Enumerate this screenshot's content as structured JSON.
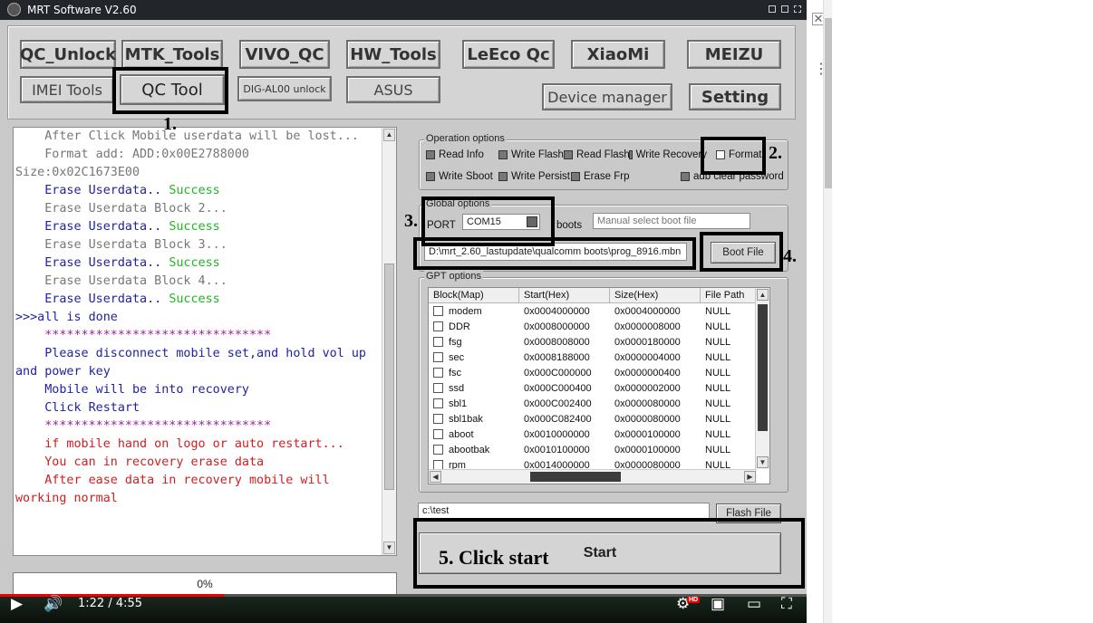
{
  "window": {
    "title": "MRT Software V2.60"
  },
  "top_buttons": {
    "qc_unlock": "QC_Unlock",
    "mtk_tools": "MTK_Tools",
    "vivo_qc": "VIVO_QC",
    "hw_tools": "HW_Tools",
    "leeco_qc": "LeEco Qc",
    "xiaomi": "XiaoMi",
    "meizu": "MEIZU",
    "imei_tools": "IMEI Tools",
    "qc_tool": "QC Tool",
    "dig_unlock": "DIG-AL00 unlock",
    "asus": "ASUS",
    "device_manager": "Device manager",
    "setting": "Setting"
  },
  "log_lines": [
    {
      "text": "    After Click Mobile userdata will be lost...",
      "color": "#777777"
    },
    {
      "text": "    Format add: ADD:0x00E2788000",
      "color": "#777777"
    },
    {
      "text": "Size:0x02C1673E00",
      "color": "#777777"
    },
    {
      "text": "    Erase Userdata.. ",
      "color": "#1f1fa0",
      "suffix": "Success",
      "suffix_color": "#22b422"
    },
    {
      "text": "    Erase Userdata Block 2...",
      "color": "#777777"
    },
    {
      "text": "    Erase Userdata.. ",
      "color": "#1f1fa0",
      "suffix": "Success",
      "suffix_color": "#22b422"
    },
    {
      "text": "    Erase Userdata Block 3...",
      "color": "#777777"
    },
    {
      "text": "    Erase Userdata.. ",
      "color": "#1f1fa0",
      "suffix": "Success",
      "suffix_color": "#22b422"
    },
    {
      "text": "    Erase Userdata Block 4...",
      "color": "#777777"
    },
    {
      "text": "    Erase Userdata.. ",
      "color": "#1f1fa0",
      "suffix": "Success",
      "suffix_color": "#22b422"
    },
    {
      "text": ">>>all is done",
      "color": "#1f1fa0"
    },
    {
      "text": "    *******************************",
      "color": "#a020a0"
    },
    {
      "text": "    Please disconnect mobile set,and hold vol up",
      "color": "#1f1fa0"
    },
    {
      "text": "and power key",
      "color": "#1f1fa0"
    },
    {
      "text": "    Mobile will be into recovery",
      "color": "#1f1fa0"
    },
    {
      "text": "    Click Restart",
      "color": "#1f1fa0"
    },
    {
      "text": "    *******************************",
      "color": "#a020a0"
    },
    {
      "text": "    if mobile hand on logo or auto restart...",
      "color": "#cc2020"
    },
    {
      "text": "    You can in recovery erase data",
      "color": "#cc2020"
    },
    {
      "text": "    After ease data in recovery mobile will",
      "color": "#cc2020"
    },
    {
      "text": "working normal",
      "color": "#cc2020"
    }
  ],
  "progress": {
    "label": "0%",
    "value": 0
  },
  "operation_options": {
    "legend": "Operation options",
    "read_info": "Read Info",
    "write_flash": "Write Flash",
    "read_flash": "Read Flash",
    "write_recovery": "Write Recovery",
    "format": "Format",
    "write_sboot": "Write Sboot",
    "write_persist": "Write Persist",
    "erase_frp": "Erase Frp",
    "adb_clear_password": "adb clear password"
  },
  "global_options": {
    "legend": "Global options",
    "port_label": "PORT",
    "port_value": "COM15",
    "boots_label": "boots",
    "boot_file_placeholder": "Manual select boot file",
    "boot_path": "D:\\mrt_2.60_lastupdate\\qualcomm boots\\prog_8916.mbn",
    "boot_file_button": "Boot File"
  },
  "gpt": {
    "legend": "GPT options",
    "columns": [
      "Block(Map)",
      "Start(Hex)",
      "Size(Hex)",
      "File Path"
    ],
    "rows": [
      [
        "modem",
        "0x0004000000",
        "0x0004000000",
        "NULL"
      ],
      [
        "DDR",
        "0x0008000000",
        "0x0000008000",
        "NULL"
      ],
      [
        "fsg",
        "0x0008008000",
        "0x0000180000",
        "NULL"
      ],
      [
        "sec",
        "0x0008188000",
        "0x0000004000",
        "NULL"
      ],
      [
        "fsc",
        "0x000C000000",
        "0x0000000400",
        "NULL"
      ],
      [
        "ssd",
        "0x000C000400",
        "0x0000002000",
        "NULL"
      ],
      [
        "sbl1",
        "0x000C002400",
        "0x0000080000",
        "NULL"
      ],
      [
        "sbl1bak",
        "0x000C082400",
        "0x0000080000",
        "NULL"
      ],
      [
        "aboot",
        "0x0010000000",
        "0x0000100000",
        "NULL"
      ],
      [
        "abootbak",
        "0x0010100000",
        "0x0000100000",
        "NULL"
      ],
      [
        "rpm",
        "0x0014000000",
        "0x0000080000",
        "NULL"
      ]
    ]
  },
  "flash": {
    "path": "c:\\test",
    "button": "Flash File"
  },
  "start": {
    "label": "Start"
  },
  "annotations": {
    "a1": "1.",
    "a2": "2.",
    "a3": "3.",
    "a4": "4.",
    "a5": "5. Click start"
  },
  "player": {
    "time": "1:22 / 4:55",
    "played_fraction": 0.278,
    "hd_badge": "HD"
  },
  "colors": {
    "accent_red": "#e00000",
    "success_green": "#22b422",
    "log_blue": "#1f1fa0"
  }
}
